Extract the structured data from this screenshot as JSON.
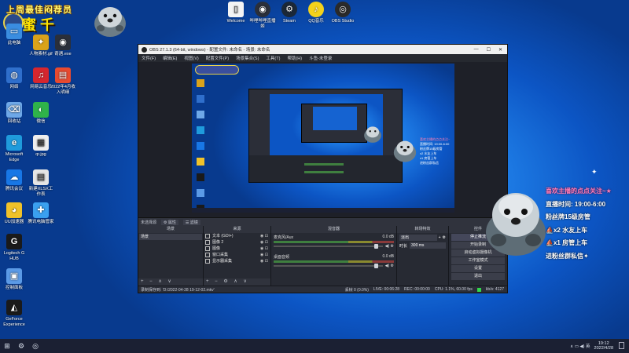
{
  "banner": {
    "title": "上周最佳闷荐员",
    "name": "蜜 千"
  },
  "desktop_icons": [
    {
      "key": "pc",
      "label": "此电脑",
      "glyph": "▭",
      "bg": "#3a8de0"
    },
    {
      "key": "gif",
      "label": "人物素材.gif",
      "glyph": "✦",
      "bg": "#d9a21a"
    },
    {
      "key": "qiyu",
      "label": "奇遇.exe",
      "glyph": "◉",
      "bg": "#2a2f3a"
    },
    {
      "key": "net",
      "label": "网络",
      "glyph": "◍",
      "bg": "#2f6fcc"
    },
    {
      "key": "netease",
      "label": "网易云音乐",
      "glyph": "♫",
      "bg": "#d6262e"
    },
    {
      "key": "pdf",
      "label": "2022年4月收入明细",
      "glyph": "▤",
      "bg": "#e84a2f"
    },
    {
      "key": "recycle",
      "label": "回收站",
      "glyph": "⌫",
      "bg": "#6ea8e8"
    },
    {
      "key": "wechat",
      "label": "微信",
      "glyph": "◐",
      "bg": "#2fb34a"
    },
    {
      "key": "edge",
      "label": "Microsoft Edge",
      "glyph": "e",
      "bg": "#1f9bdc"
    },
    {
      "key": "qrcode",
      "label": "qr.jpg",
      "glyph": "▦",
      "bg": "#eeeeee"
    },
    {
      "key": "cloud",
      "label": "腾讯会议",
      "glyph": "☁",
      "bg": "#1877e6"
    },
    {
      "key": "xls",
      "label": "新建XLSX工作表",
      "glyph": "▤",
      "bg": "#e5e5e5"
    },
    {
      "key": "uu",
      "label": "UU加速器",
      "glyph": "◕",
      "bg": "#f0c22a"
    },
    {
      "key": "qqpc",
      "label": "腾讯电脑管家",
      "glyph": "✚",
      "bg": "#3aa0f0"
    },
    {
      "key": "logi",
      "label": "Logitech G HUB",
      "glyph": "G",
      "bg": "#1a1a1a"
    },
    {
      "key": "ctrl",
      "label": "控制面板",
      "glyph": "▣",
      "bg": "#5b9ae6"
    },
    {
      "key": "nvidia",
      "label": "GeForce Experience",
      "glyph": "◭",
      "bg": "#1a1a1a"
    }
  ],
  "top_icons": [
    {
      "key": "welcome",
      "label": "Welcome",
      "glyph": "▯",
      "bg": "#f4f4f4"
    },
    {
      "key": "bilibili",
      "label": "哔哩哔哩直播姬",
      "glyph": "◉",
      "bg": "#2a2f3a"
    },
    {
      "key": "steam",
      "label": "Steam",
      "glyph": "⚙",
      "bg": "#1b2838"
    },
    {
      "key": "qqmusic",
      "label": "QQ音乐",
      "glyph": "♪",
      "bg": "#f3d21c"
    },
    {
      "key": "obs",
      "label": "OBS Studio",
      "glyph": "◎",
      "bg": "#2a2a2a"
    }
  ],
  "obs": {
    "title": "OBS 27.1.3 (64-bit, windows) - 配置文件: 未命名 - 场景: 未命名",
    "menu": [
      "文件(F)",
      "编辑(E)",
      "视图(V)",
      "配置文件(P)",
      "场景集合(S)",
      "工具(T)",
      "帮助(H)",
      "斗鱼-未登录"
    ],
    "scene_bar": [
      "未选择源",
      "⚙ 属性",
      "☰ 滤镜"
    ],
    "docks": {
      "scenes_title": "场景",
      "scenes": [
        "场景"
      ],
      "sources_title": "来源",
      "sources": [
        "文本 (GDI+)",
        "图像 2",
        "图像",
        "窗口采集",
        "显示器采集"
      ],
      "mixer_title": "混音器",
      "mixer": [
        {
          "name": "麦克风/Aux",
          "db": "0.0 dB"
        },
        {
          "name": "桌面音频",
          "db": "0.0 dB"
        }
      ],
      "transitions_title": "转场特效",
      "transition": "淡出",
      "duration_label": "时长",
      "duration": "300 ms",
      "controls_title": "控件",
      "controls": [
        "停止推流",
        "开始录制",
        "启动虚拟摄像机",
        "工作室模式",
        "设置",
        "退出"
      ]
    },
    "status": {
      "saved": "录制保存到: 'D:/2022-04-28 19-12-02.mkv'",
      "dropped": "丢帧 0 (0.0%)",
      "live": "LIVE: 00:06:28",
      "rec": "REC: 00:00:00",
      "cpu": "CPU: 1.1%, 60.00 fps",
      "kbps": "kb/s: 4127"
    }
  },
  "overlay": {
    "lines": [
      {
        "text": "喜欢主播的点点关注~",
        "style": "pink"
      },
      {
        "text": "直播时间: 19:00-6:00",
        "style": "white"
      },
      {
        "text": "粉丝牌15级房管",
        "style": "white"
      },
      {
        "text": "x2 水友上车",
        "style": "white"
      },
      {
        "text": "x1 房管上车",
        "style": "white"
      },
      {
        "text": "进粉丝群私信",
        "style": "white"
      }
    ]
  },
  "taskbar": {
    "time": "19:12",
    "date": "2022/4/28",
    "lang": "英",
    "tray_symbols": "∧ ▭ ◀) 英"
  }
}
